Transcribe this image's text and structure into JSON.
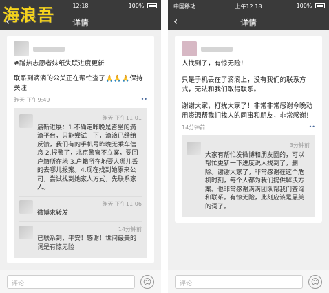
{
  "watermark": "海浪吾",
  "left": {
    "status": {
      "carrier": "",
      "time": "12:18",
      "battery": "100%"
    },
    "nav": {
      "back": "‹",
      "title": "详情"
    },
    "post": {
      "text1": "#蹭热志愿者妹纸失联进度更新",
      "text2": "联系到滴滴的公关正在帮忙查了🙏🙏🙏保持关注",
      "time": "昨天 下午9:49"
    },
    "comments": [
      {
        "time": "昨天 下午11:01",
        "text": "最新进展：1.不确定昨晚是否坐的滴滴平台，只能尝试一下，滴滴已经给反馈，我们有的手机号昨晚无乘车信息 2.报警了，北京警察不立案，要回户籍所在地 3.户籍所在地要人哪儿丢的去哪儿报案。4.现在找到她原来公司，尝试找到她家人方式，先联系家人。"
      },
      {
        "time": "昨天 下午11:06",
        "text": "微博求转发"
      },
      {
        "time": "14分钟前",
        "text": "已联系到，平安！感谢！世间最美的词是有惊无险"
      }
    ],
    "input": {
      "placeholder": "评论",
      "emoji": "☺"
    }
  },
  "right": {
    "status": {
      "carrier": "中国移动",
      "time": "上午12:18",
      "battery": "100%"
    },
    "nav": {
      "back": "‹",
      "title": "详情"
    },
    "post": {
      "text1": "人找到了，有惊无险！",
      "text2": "只是手机丢在了滴滴上，没有我们的联系方式，无法和我们取得联系。",
      "text3": "谢谢大家，打扰大家了！非常非常感谢今晚动用资源帮我们找人的同事和朋友，非常感谢！",
      "time": "14分钟前"
    },
    "comments": [
      {
        "time": "3分钟前",
        "text": "大家有帮忙发微博和朋友圈的，可以帮忙更新一下进度说人找到了，删除。谢谢大家了，非常感谢在这个危机时刻，每个人都为我们提供解决方案。也非常感谢滴滴团队帮我们查询和联系。有惊无险，此刻应该是最美的词了。"
      }
    ],
    "input": {
      "placeholder": "评论",
      "emoji": "☺"
    }
  }
}
